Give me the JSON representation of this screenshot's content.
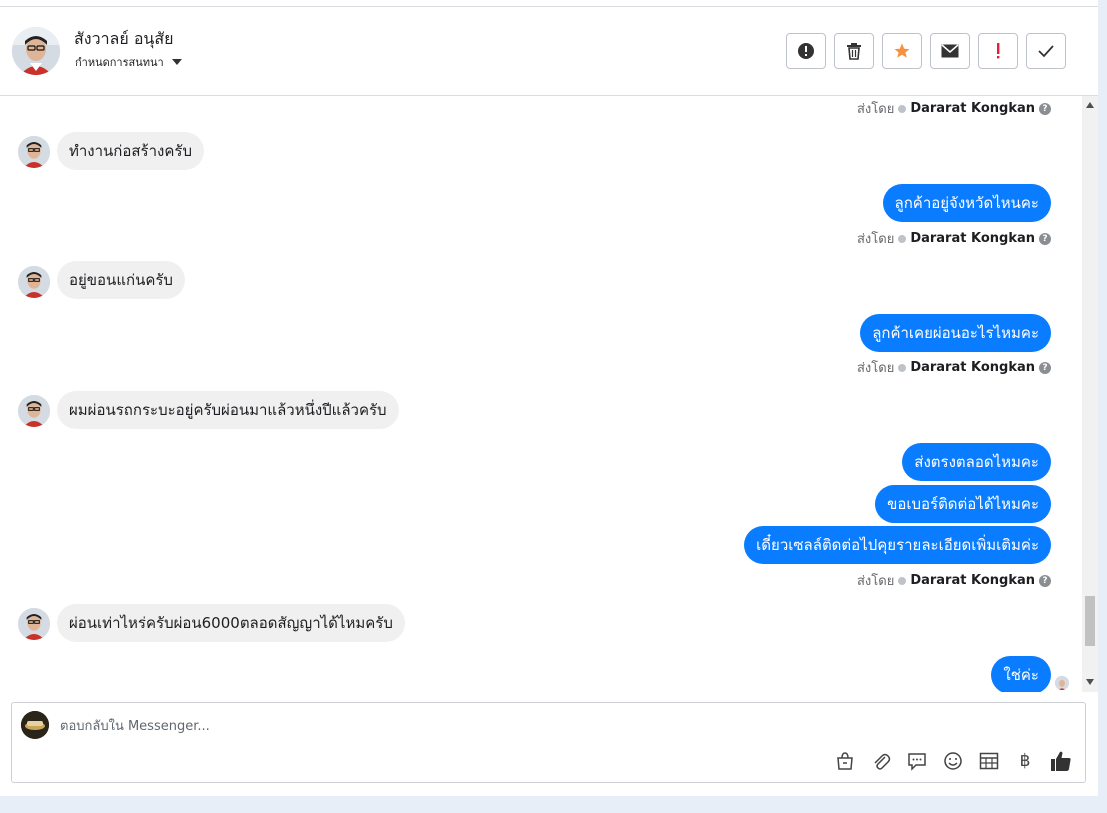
{
  "header": {
    "contact_name": "สังวาลย์ อนุสัย",
    "assign_label": "กำหนดการสนทนา",
    "actions": [
      {
        "name": "spam-button",
        "icon": "alert-circle-icon"
      },
      {
        "name": "delete-button",
        "icon": "trash-icon"
      },
      {
        "name": "star-button",
        "icon": "star-icon"
      },
      {
        "name": "mark-unread-button",
        "icon": "envelope-icon"
      },
      {
        "name": "follow-up-button",
        "icon": "exclamation-icon"
      },
      {
        "name": "mark-done-button",
        "icon": "check-icon"
      }
    ]
  },
  "conversation": {
    "sent_by_label": "ส่งโดย",
    "agent_name": "Dararat Kongkan",
    "incoming": [
      "ทำงานก่อสร้างครับ",
      "อยู่ขอนแก่นครับ",
      "ผมผ่อนรถกระบะอยู่ครับผ่อนมาแล้วหนึ่งปีแล้วครับ",
      "ผ่อนเท่าไหร่ครับผ่อน6000ตลอดสัญญาได้ไหมครับ"
    ],
    "outgoing": [
      "ลูกค้าอยู่จังหวัดไหนคะ",
      "ลูกค้าเคยผ่อนอะไรไหมคะ",
      "ส่งตรงตลอดไหมคะ",
      "ขอเบอร์ติดต่อได้ไหมคะ",
      "เดี๋ยวเซลล์ติดต่อไปคุยรายละเอียดเพิ่มเติมค่ะ",
      "ใช่ค่ะ"
    ]
  },
  "composer": {
    "placeholder": "ตอบกลับใน Messenger...",
    "value": "",
    "baht_symbol": "฿",
    "tools": [
      "saved-replies-icon",
      "attachment-icon",
      "message-template-icon",
      "emoji-icon",
      "appointment-icon",
      "payment-baht-icon",
      "like-icon"
    ]
  },
  "colors": {
    "outgoing_bubble": "#0a7cff",
    "incoming_bubble": "#f0f0f0",
    "star": "#f5923e",
    "follow_up": "#e41e3f"
  }
}
